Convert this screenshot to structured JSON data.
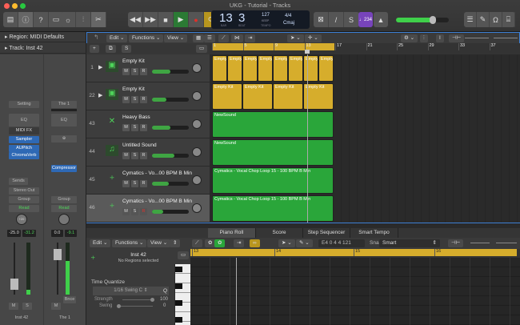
{
  "window": {
    "title": "UKG - Tutorial - Tracks"
  },
  "lcd": {
    "bar": "13",
    "beat": "3",
    "bar_label": "BAR",
    "beat_label": "BEAT",
    "tempo": "127",
    "tempo_mode": "KEEP",
    "tempo_label": "TEMPO",
    "signature": "4/4",
    "key": "Cmaj"
  },
  "toolbar": {
    "count_in": "♩234"
  },
  "inspector": {
    "region": "Region: MIDI Defaults",
    "track": "Track: Inst 42",
    "strip1": {
      "setting": "Setting",
      "eq": "EQ",
      "midi_fx": "MIDI FX",
      "instrument": "Sampler",
      "fx": [
        "AUPitch",
        "ChromaVerb"
      ],
      "sends": "Sends",
      "output": "Stereo Out",
      "group": "Group",
      "automation": "Read",
      "pan": "+20",
      "volume": "-25.0",
      "peak": "-31.2",
      "mute": "M",
      "solo": "S",
      "name": "Inst 42"
    },
    "strip2": {
      "setting": "The 1",
      "eq": "EQ",
      "fx": [
        "Compressor"
      ],
      "group": "Group",
      "automation": "Read",
      "volume": "0.0",
      "peak": "-9.1",
      "mute": "M",
      "bounce": "Bnce",
      "name": "The 1"
    }
  },
  "tracks_menu": {
    "edit": "Edit",
    "functions": "Functions",
    "view": "View"
  },
  "ruler": [
    "1",
    "5",
    "9",
    "13",
    "17",
    "21",
    "25",
    "29",
    "33",
    "37"
  ],
  "tracks": [
    {
      "num": "1",
      "name": "Empty Kit",
      "vol": 0.3,
      "rec_armed": false
    },
    {
      "num": "22",
      "name": "Empty Kit",
      "vol": 0.2,
      "rec_armed": false
    },
    {
      "num": "43",
      "name": "Heavy Bass",
      "vol": 0.3,
      "rec_armed": false
    },
    {
      "num": "44",
      "name": "Untitled Sound",
      "vol": 0.4,
      "rec_armed": false
    },
    {
      "num": "45",
      "name": "Cymatics - Vo...00 BPM B Min",
      "vol": 0.25,
      "rec_armed": false
    },
    {
      "num": "46",
      "name": "Cymatics - Vo...00 BPM B Min",
      "vol": 0.1,
      "rec_armed": true
    }
  ],
  "msr": {
    "m": "M",
    "s": "S",
    "r": "R"
  },
  "regions": {
    "kit1": "Empty",
    "kit2": "Empty Kit",
    "bass": "NewSound",
    "sound": "NewSound",
    "vocal": "Cymatics - Vocal Chop Loop 15 - 100 BPM B Min"
  },
  "editor": {
    "tabs": [
      "Piano Roll",
      "Score",
      "Step Sequencer",
      "Smart Tempo"
    ],
    "edit": "Edit",
    "functions": "Functions",
    "view": "View",
    "position": "E4   0 4 4 121",
    "snap_label": "Snap:",
    "snap": "Smart",
    "track_name": "Inst 42",
    "selection": "No Regions selected",
    "tq_label": "Time Quantize",
    "tq_value": "1/16 Swing C",
    "q": "Q",
    "strength_label": "Strength",
    "strength": "100",
    "swing_label": "Swing",
    "swing": "0",
    "ruler": [
      "13",
      "14",
      "15",
      "16"
    ]
  }
}
